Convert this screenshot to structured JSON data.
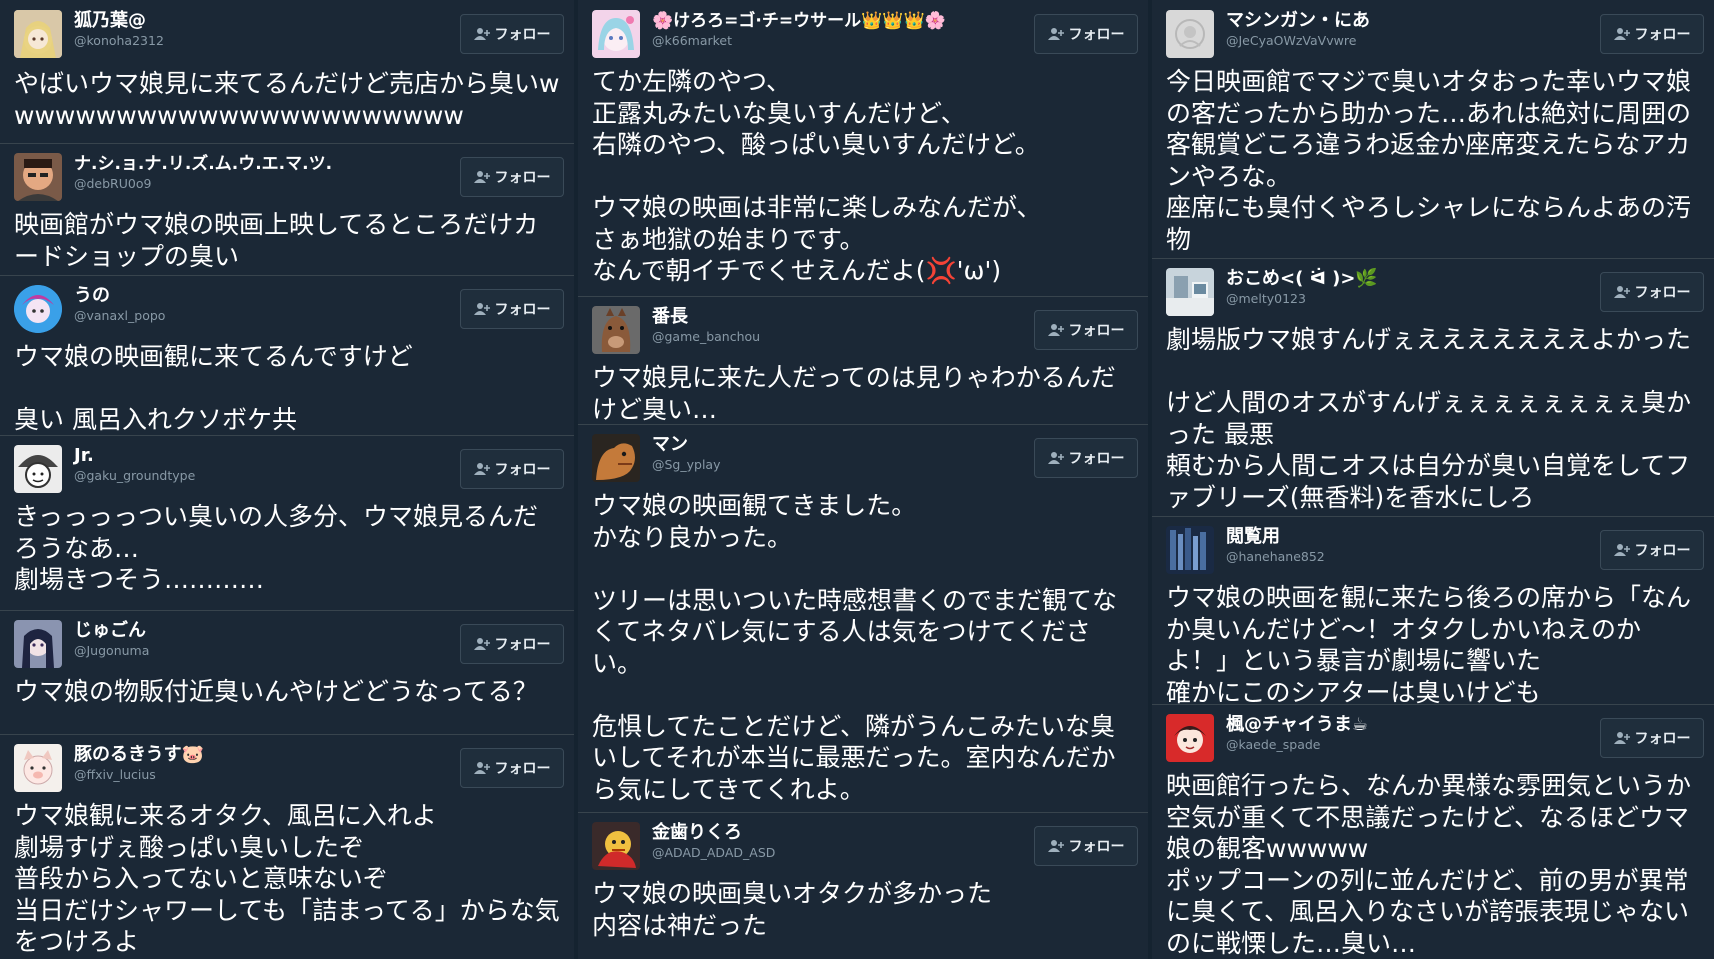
{
  "follow_label": "フォロー",
  "columns": [
    [
      {
        "name": "狐乃葉@",
        "handle": "@konoha2312",
        "text": "やばいウマ娘見に来てるんだけど売店から臭いwwwwwwwwwwwwwwwwwwwwwww"
      },
      {
        "name": "ナ.シ.ョ.ナ.リ.ズ.ム.ウ.エ.マ.ツ.",
        "handle": "@debRU0o9",
        "text": "映画館がウマ娘の映画上映してるところだけカードショップの臭い"
      },
      {
        "name": "うの",
        "handle": "@vanaxl_popo",
        "text": "ウマ娘の映画観に来てるんですけど\n\n臭い 風呂入れクソボケ共"
      },
      {
        "name": "Jr.",
        "handle": "@gaku_groundtype",
        "text": "きっっっっつい臭いの人多分、ウマ娘見るんだろうなあ…\n劇場きつそう…………"
      },
      {
        "name": "じゅごん",
        "handle": "@Jugonuma",
        "text": "ウマ娘の物販付近臭いんやけどどうなってる？"
      },
      {
        "name": "豚のるきうす🐷",
        "handle": "@ffxiv_lucius",
        "text": "ウマ娘観に来るオタク、風呂に入れよ\n劇場すげぇ酸っぱい臭いしたぞ\n普段から入ってないと意味ないぞ\n当日だけシャワーしても「詰まってる」からな気をつけろよ"
      }
    ],
    [
      {
        "name": "🌸けろろ=ゴ·チ=ウサール👑👑👑🌸",
        "handle": "@k66market",
        "text": "てか左隣のやつ、\n正露丸みたいな臭いすんだけど、\n右隣のやつ、酸っぱい臭いすんだけど。\n\nウマ娘の映画は非常に楽しみなんだが、\nさぁ地獄の始まりです。\nなんで朝イチでくせえんだよ(💢'ω')"
      },
      {
        "name": "番長",
        "handle": "@game_banchou",
        "text": "ウマ娘見に来た人だってのは見りゃわかるんだけど臭い…"
      },
      {
        "name": "マン",
        "handle": "@Sg_yplay",
        "text": "ウマ娘の映画観てきました。\nかなり良かった。\n\nツリーは思いついた時感想書くのでまだ観てなくてネタバレ気にする人は気をつけてください。\n\n危惧してたことだけど、隣がうんこみたいな臭いしてそれが本当に最悪だった。室内なんだから気にしてきてくれよ。"
      },
      {
        "name": "金歯りくろ",
        "handle": "@ADAD_ADAD_ASD",
        "text": "ウマ娘の映画臭いオタクが多かった\n内容は神だった"
      }
    ],
    [
      {
        "name": "マシンガン・にあ",
        "handle": "@JeCyaOWzVaVvwre",
        "text": "今日映画館でマジで臭いオタおった幸いウマ娘の客だったから助かった…あれは絶対に周囲の客観賞どころ違うわ返金か座席変えたらなアカンやろな。\n座席にも臭付くやろしシャレにならんよあの汚物"
      },
      {
        "name": "おこめ<( ᐛ )>🌿",
        "handle": "@melty0123",
        "text": "劇場版ウマ娘すんげぇえええええええよかった\n\nけど人間のオスがすんげぇぇぇぇぇぇぇぇ臭かった 最悪\n頼むから人間こオスは自分が臭い自覚をしてファブリーズ(無香料)を香水にしろ"
      },
      {
        "name": "閲覧用",
        "handle": "@hanehane852",
        "text": "ウマ娘の映画を観に来たら後ろの席から「なんか臭いんだけど〜！オタクしかいねえのかよ！」という暴言が劇場に響いた\n確かにこのシアターは臭いけども"
      },
      {
        "name": "楓@チャイうま☕",
        "handle": "@kaede_spade",
        "text": "映画館行ったら、なんか異様な雰囲気というか空気が重くて不思議だったけど、なるほどウマ娘の観客wwwww\nポップコーンの列に並んだけど、前の男が異常に臭くて、風呂入りなさいが誇張表現じゃないのに戦慄した…臭い…"
      }
    ]
  ]
}
